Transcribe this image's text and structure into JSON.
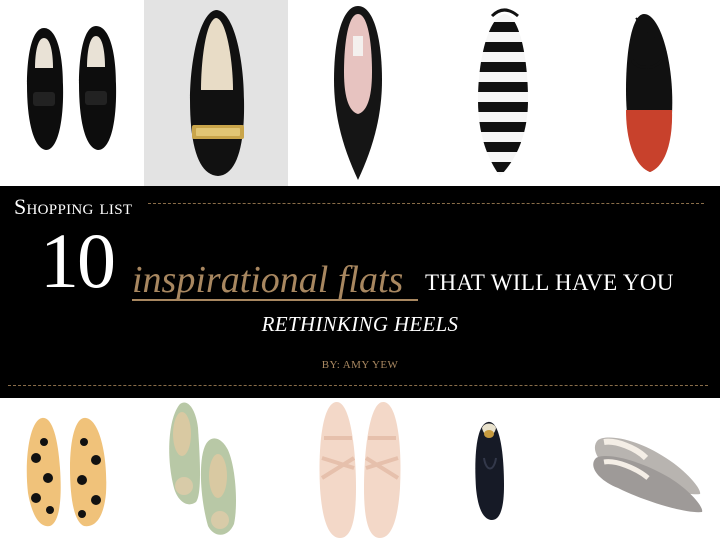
{
  "header": {
    "kicker": "Shopping list",
    "number": "10",
    "accent_phrase": "inspirational flats",
    "title_rest": "THAT WILL HAVE YOU",
    "title_line2": "RETHINKING HEELS",
    "byline": "BY: AMY YEW"
  },
  "colors": {
    "band": "#000000",
    "accent": "#a88760",
    "text": "#ffffff"
  },
  "products": [
    {
      "icon": "black-loafers-icon"
    },
    {
      "icon": "black-gold-buckle-flat-icon"
    },
    {
      "icon": "black-pointed-flat-icon"
    },
    {
      "icon": "striped-slingback-flat-icon"
    },
    {
      "icon": "red-ankle-strap-flat-icon"
    },
    {
      "icon": "polka-dot-flats-icon"
    },
    {
      "icon": "mint-ballet-flats-icon"
    },
    {
      "icon": "blush-studded-flats-icon"
    },
    {
      "icon": "black-smoking-slipper-icon"
    },
    {
      "icon": "gray-pointed-flats-icon"
    }
  ]
}
